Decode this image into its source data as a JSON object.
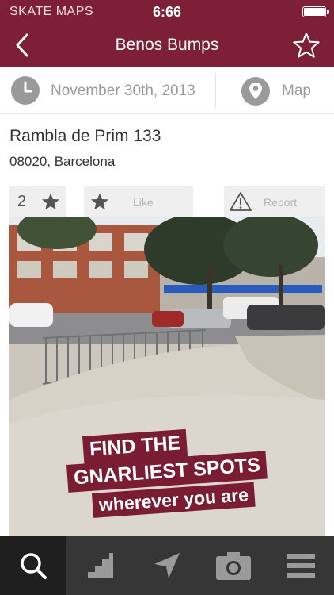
{
  "status_bar": {
    "carrier": "SKATE MAPS",
    "time": "6:66"
  },
  "nav": {
    "title": "Benos Bumps",
    "back_icon": "chevron-left-icon",
    "favorite_icon": "star-outline-icon"
  },
  "info": {
    "date": "November 30th, 2013",
    "map_label": "Map",
    "date_icon": "clock-icon",
    "map_icon": "location-pin-icon"
  },
  "address": {
    "line1": "Rambla de Prim 133",
    "line2": "08020, Barcelona"
  },
  "actions": {
    "star_count": "2",
    "like_label": "Like",
    "report_label": "Report"
  },
  "photo": {
    "promo_line1": "FIND THE",
    "promo_line2": "GNARLIEST SPOTS",
    "promo_line3": "wherever you are"
  },
  "tabbar": {
    "tabs": [
      {
        "icon": "search-icon",
        "active": true
      },
      {
        "icon": "stairs-icon",
        "active": false
      },
      {
        "icon": "navigation-arrow-icon",
        "active": false
      },
      {
        "icon": "camera-icon",
        "active": false
      },
      {
        "icon": "menu-icon",
        "active": false
      }
    ]
  },
  "colors": {
    "brand": "#7d1f36",
    "tabbar": "#363636",
    "tab_active": "#1f1f1f",
    "muted_text": "#9a9a9a"
  }
}
